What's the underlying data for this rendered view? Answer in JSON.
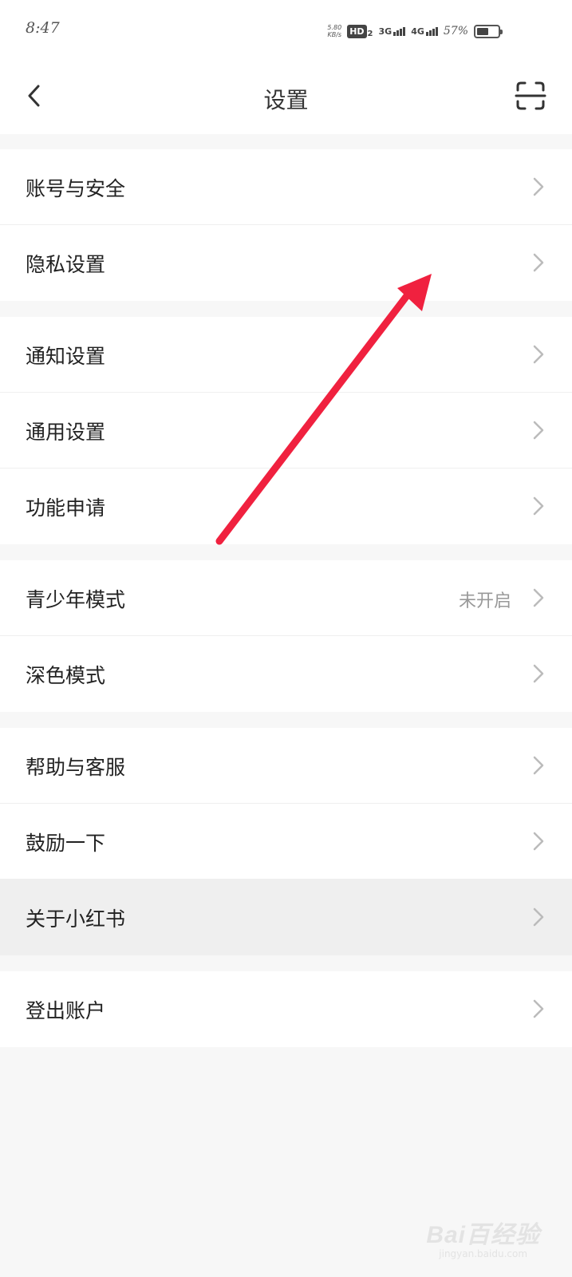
{
  "status_bar": {
    "time": "8:47",
    "speed_value": "5.80",
    "speed_unit": "KB/s",
    "hd_label": "HD",
    "hd_sub": "2",
    "net1_label": "3G",
    "net2_label": "4G",
    "battery_percent": "57%",
    "battery_level": 0.57
  },
  "header": {
    "title": "设置",
    "back_icon": "chevron-left-icon",
    "scan_icon": "scan-icon"
  },
  "settings": {
    "account_security": {
      "label": "账号与安全"
    },
    "privacy": {
      "label": "隐私设置"
    },
    "notifications": {
      "label": "通知设置"
    },
    "general": {
      "label": "通用设置"
    },
    "feature_request": {
      "label": "功能申请"
    },
    "youth_mode": {
      "label": "青少年模式",
      "value": "未开启"
    },
    "dark_mode": {
      "label": "深色模式"
    },
    "help_support": {
      "label": "帮助与客服"
    },
    "encourage": {
      "label": "鼓励一下"
    },
    "about": {
      "label": "关于小红书"
    },
    "logout": {
      "label": "登出账户"
    }
  },
  "annotation": {
    "arrow_color": "#f0213f"
  },
  "watermark": {
    "main": "Bai百经验",
    "sub": "jingyan.baidu.com"
  }
}
